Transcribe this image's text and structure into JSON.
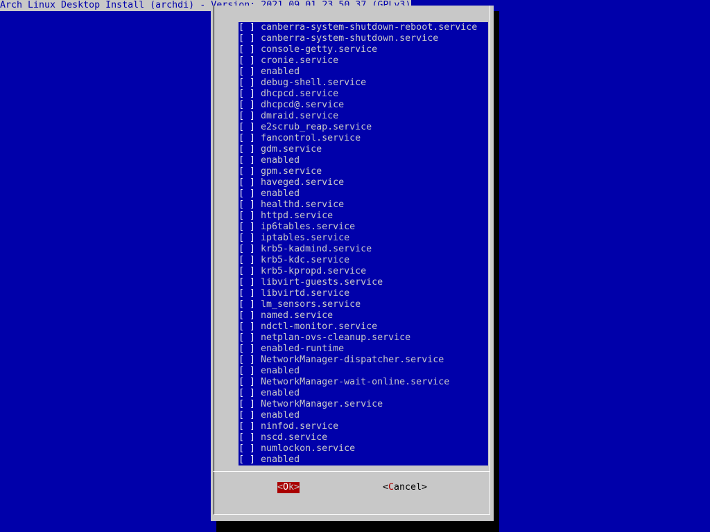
{
  "title": "Arch Linux Desktop Install (archdi) - Version: 2021.09.01.23.50.37 (GPLv3)",
  "colors": {
    "background": "#0000aa",
    "dialog": "#c8c8c8",
    "list_text": "#c8c8c8",
    "ok_button": "#aa0000"
  },
  "checkbox_unchecked": "[ ]",
  "items": [
    "canberra-system-shutdown-reboot.service",
    "canberra-system-shutdown.service",
    "console-getty.service",
    "cronie.service",
    "enabled",
    "debug-shell.service",
    "dhcpcd.service",
    "dhcpcd@.service",
    "dmraid.service",
    "e2scrub_reap.service",
    "fancontrol.service",
    "gdm.service",
    "enabled",
    "gpm.service",
    "haveged.service",
    "enabled",
    "healthd.service",
    "httpd.service",
    "ip6tables.service",
    "iptables.service",
    "krb5-kadmind.service",
    "krb5-kdc.service",
    "krb5-kpropd.service",
    "libvirt-guests.service",
    "libvirtd.service",
    "lm_sensors.service",
    "named.service",
    "ndctl-monitor.service",
    "netplan-ovs-cleanup.service",
    "enabled-runtime",
    "NetworkManager-dispatcher.service",
    "enabled",
    "NetworkManager-wait-online.service",
    "enabled",
    "NetworkManager.service",
    "enabled",
    "ninfod.service",
    "nscd.service",
    "numlockon.service",
    "enabled"
  ],
  "buttons": {
    "ok": {
      "open": "<",
      "hot": "O",
      "rest": "k>"
    },
    "cancel": {
      "open": "<",
      "hot": "C",
      "rest": "ancel>"
    }
  }
}
